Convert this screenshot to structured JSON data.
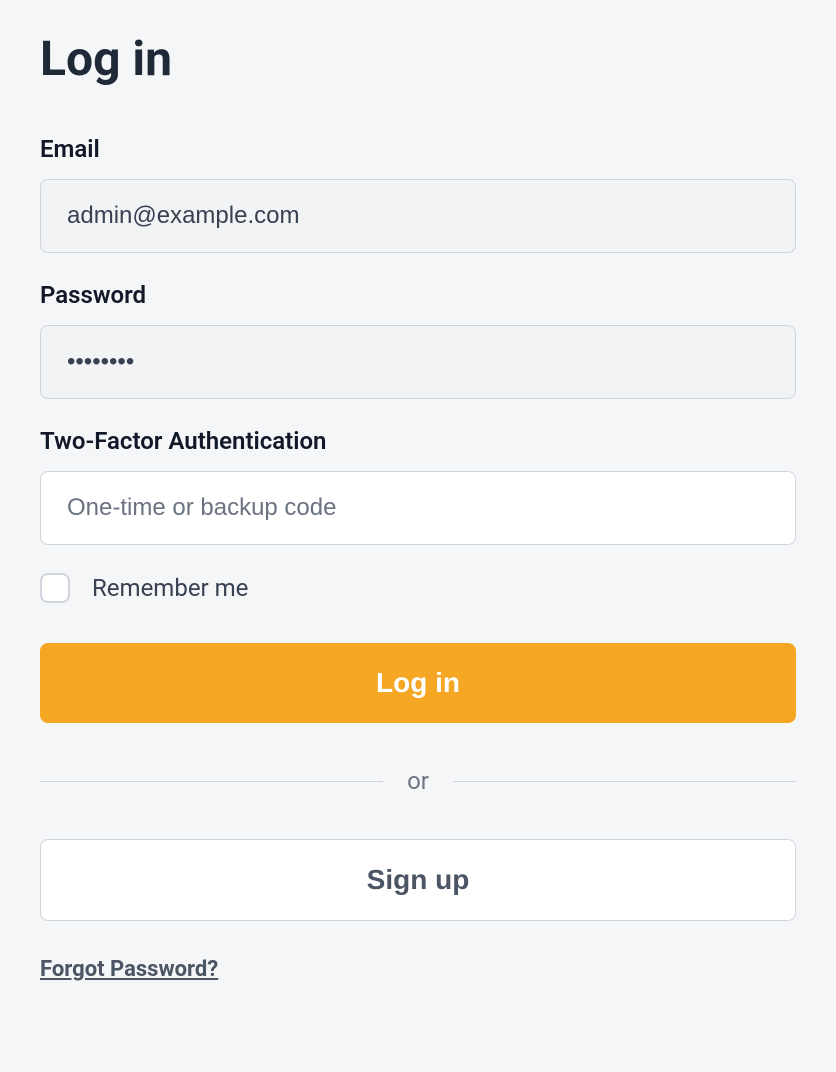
{
  "title": "Log in",
  "fields": {
    "email": {
      "label": "Email",
      "value": "admin@example.com"
    },
    "password": {
      "label": "Password",
      "value": "••••••••"
    },
    "twofa": {
      "label": "Two-Factor Authentication",
      "placeholder": "One-time or backup code",
      "value": ""
    }
  },
  "remember": {
    "label": "Remember me",
    "checked": false
  },
  "buttons": {
    "login": "Log in",
    "signup": "Sign up"
  },
  "divider": "or",
  "forgot": "Forgot Password?",
  "colors": {
    "primary": "#f5a623",
    "text_dark": "#1f2937",
    "text_medium": "#4b5563",
    "text_light": "#6b7280",
    "border": "#d1d5db",
    "input_bg": "#f2f3f5",
    "page_bg": "#f5f6f8"
  }
}
